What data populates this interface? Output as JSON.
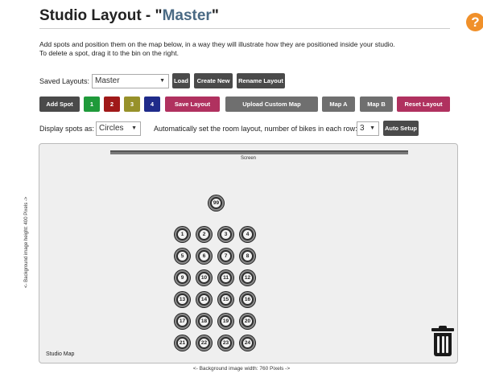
{
  "header": {
    "title_prefix": "Studio Layout - ",
    "quote_open": "\"",
    "title_name": "Master",
    "quote_close": "\"",
    "help_icon": "?"
  },
  "description": {
    "line1": "Add spots and position them on the map below, in a way they will illustrate how they are positioned inside your studio.",
    "line2": "To delete a spot, drag it to the bin on the right."
  },
  "saved_layouts": {
    "label": "Saved Layouts:",
    "selected": "Master",
    "load": "Load",
    "create_new": "Create New",
    "rename": "Rename Layout"
  },
  "toolbar": {
    "add_spot": "Add Spot",
    "type1": "1",
    "type2": "2",
    "type3": "3",
    "type4": "4",
    "save_layout": "Save Layout",
    "upload_map": "Upload Custom Map",
    "map_a": "Map A",
    "map_b": "Map B",
    "reset_layout": "Reset Layout"
  },
  "display": {
    "label": "Display spots as:",
    "selected": "Circles",
    "auto_label": "Automatically set the room layout, number of bikes in each row:",
    "bikes_per_row": "3",
    "auto_setup": "Auto Setup"
  },
  "map": {
    "screen_label": "Screen",
    "map_name": "Studio Map",
    "height_label": "<- Background image height: 400 Pixels ->",
    "width_label": "<- Background image width: 760 Pixels ->",
    "spots": [
      "99",
      "1",
      "2",
      "3",
      "4",
      "5",
      "6",
      "7",
      "8",
      "9",
      "10",
      "11",
      "12",
      "13",
      "14",
      "15",
      "16",
      "17",
      "18",
      "19",
      "20",
      "21",
      "22",
      "23",
      "24"
    ]
  },
  "colors": {
    "accent": "#4a6a84",
    "help": "#f0902a",
    "magenta": "#b0315f",
    "green": "#1f9a3a",
    "red": "#a01919",
    "olive": "#97912a",
    "navy": "#1f2b8a"
  },
  "icons": {
    "help": "question-circle-icon",
    "bin": "trash-bin-icon"
  }
}
